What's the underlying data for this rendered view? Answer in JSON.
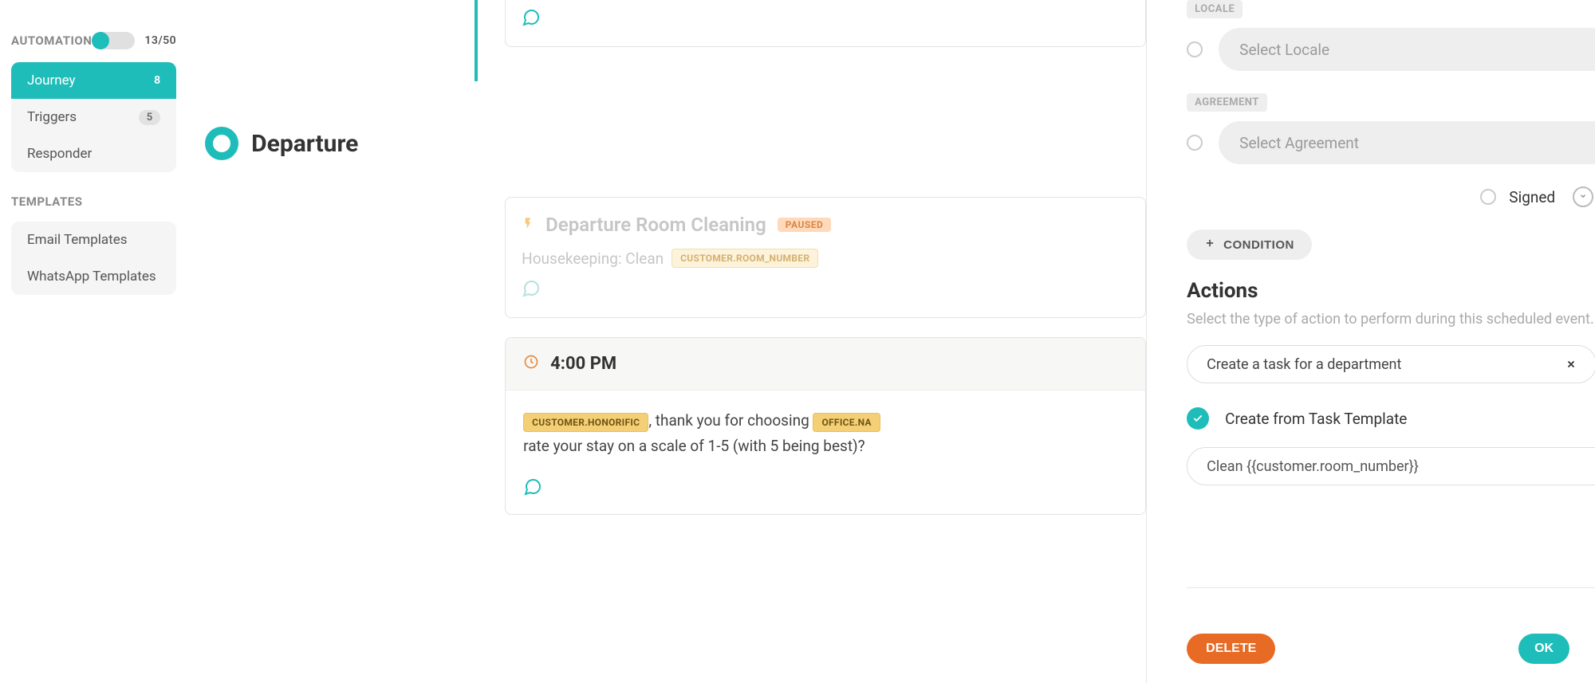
{
  "sidebar": {
    "sections": {
      "automation": {
        "title": "AUTOMATION",
        "toggle_count": "13/50",
        "items": [
          {
            "label": "Journey",
            "badge": "8",
            "active": true
          },
          {
            "label": "Triggers",
            "badge": "5",
            "active": false
          },
          {
            "label": "Responder",
            "badge": "",
            "active": false
          }
        ]
      },
      "templates": {
        "title": "TEMPLATES",
        "items": [
          {
            "label": "Email Templates"
          },
          {
            "label": "WhatsApp Templates"
          }
        ]
      }
    }
  },
  "journey": {
    "stage_title": "Departure",
    "cards": {
      "top_snippet": {
        "icon": "chat"
      },
      "cleaning": {
        "title": "Departure Room Cleaning",
        "status": "PAUSED",
        "line_prefix": "Housekeeping: Clean",
        "var1": "CUSTOMER.ROOM_NUMBER"
      },
      "message": {
        "time": "4:00 PM",
        "var_honorific": "CUSTOMER.HONORIFIC",
        "text_mid": ", thank you for choosing ",
        "var_office": "OFFICE.NA",
        "text_after": "rate your stay on a scale of 1-5 (with 5 being best)?"
      }
    }
  },
  "panel": {
    "locale": {
      "label": "LOCALE",
      "placeholder": "Select Locale"
    },
    "agreement": {
      "label": "AGREEMENT",
      "placeholder": "Select Agreement"
    },
    "signed_label": "Signed",
    "condition_btn": "CONDITION",
    "actions": {
      "title": "Actions",
      "subtitle": "Select the type of action to perform during this scheduled event.",
      "selected_action": "Create a task for a department",
      "template_toggle_label": "Create from Task Template",
      "template_value": "Clean {{customer.room_number}}"
    },
    "footer": {
      "delete": "DELETE",
      "ok": "OK"
    }
  }
}
